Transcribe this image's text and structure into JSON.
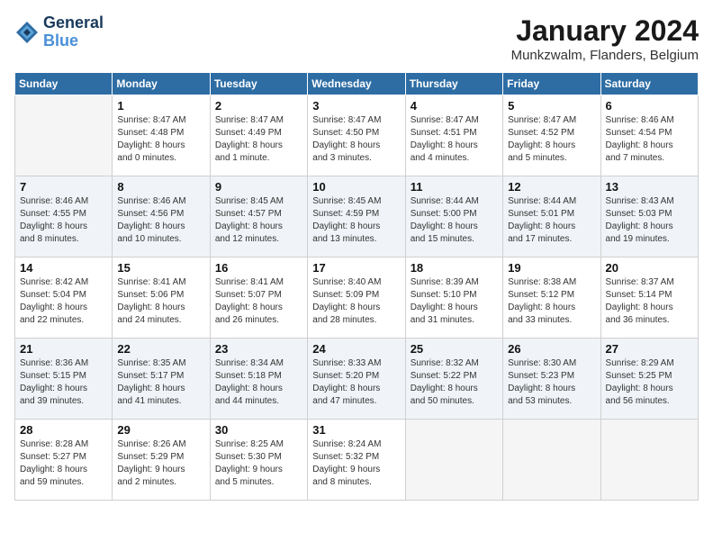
{
  "header": {
    "logo_line1": "General",
    "logo_line2": "Blue",
    "month": "January 2024",
    "location": "Munkzwalm, Flanders, Belgium"
  },
  "weekdays": [
    "Sunday",
    "Monday",
    "Tuesday",
    "Wednesday",
    "Thursday",
    "Friday",
    "Saturday"
  ],
  "weeks": [
    [
      {
        "day": "",
        "text": ""
      },
      {
        "day": "1",
        "text": "Sunrise: 8:47 AM\nSunset: 4:48 PM\nDaylight: 8 hours\nand 0 minutes."
      },
      {
        "day": "2",
        "text": "Sunrise: 8:47 AM\nSunset: 4:49 PM\nDaylight: 8 hours\nand 1 minute."
      },
      {
        "day": "3",
        "text": "Sunrise: 8:47 AM\nSunset: 4:50 PM\nDaylight: 8 hours\nand 3 minutes."
      },
      {
        "day": "4",
        "text": "Sunrise: 8:47 AM\nSunset: 4:51 PM\nDaylight: 8 hours\nand 4 minutes."
      },
      {
        "day": "5",
        "text": "Sunrise: 8:47 AM\nSunset: 4:52 PM\nDaylight: 8 hours\nand 5 minutes."
      },
      {
        "day": "6",
        "text": "Sunrise: 8:46 AM\nSunset: 4:54 PM\nDaylight: 8 hours\nand 7 minutes."
      }
    ],
    [
      {
        "day": "7",
        "text": "Sunrise: 8:46 AM\nSunset: 4:55 PM\nDaylight: 8 hours\nand 8 minutes."
      },
      {
        "day": "8",
        "text": "Sunrise: 8:46 AM\nSunset: 4:56 PM\nDaylight: 8 hours\nand 10 minutes."
      },
      {
        "day": "9",
        "text": "Sunrise: 8:45 AM\nSunset: 4:57 PM\nDaylight: 8 hours\nand 12 minutes."
      },
      {
        "day": "10",
        "text": "Sunrise: 8:45 AM\nSunset: 4:59 PM\nDaylight: 8 hours\nand 13 minutes."
      },
      {
        "day": "11",
        "text": "Sunrise: 8:44 AM\nSunset: 5:00 PM\nDaylight: 8 hours\nand 15 minutes."
      },
      {
        "day": "12",
        "text": "Sunrise: 8:44 AM\nSunset: 5:01 PM\nDaylight: 8 hours\nand 17 minutes."
      },
      {
        "day": "13",
        "text": "Sunrise: 8:43 AM\nSunset: 5:03 PM\nDaylight: 8 hours\nand 19 minutes."
      }
    ],
    [
      {
        "day": "14",
        "text": "Sunrise: 8:42 AM\nSunset: 5:04 PM\nDaylight: 8 hours\nand 22 minutes."
      },
      {
        "day": "15",
        "text": "Sunrise: 8:41 AM\nSunset: 5:06 PM\nDaylight: 8 hours\nand 24 minutes."
      },
      {
        "day": "16",
        "text": "Sunrise: 8:41 AM\nSunset: 5:07 PM\nDaylight: 8 hours\nand 26 minutes."
      },
      {
        "day": "17",
        "text": "Sunrise: 8:40 AM\nSunset: 5:09 PM\nDaylight: 8 hours\nand 28 minutes."
      },
      {
        "day": "18",
        "text": "Sunrise: 8:39 AM\nSunset: 5:10 PM\nDaylight: 8 hours\nand 31 minutes."
      },
      {
        "day": "19",
        "text": "Sunrise: 8:38 AM\nSunset: 5:12 PM\nDaylight: 8 hours\nand 33 minutes."
      },
      {
        "day": "20",
        "text": "Sunrise: 8:37 AM\nSunset: 5:14 PM\nDaylight: 8 hours\nand 36 minutes."
      }
    ],
    [
      {
        "day": "21",
        "text": "Sunrise: 8:36 AM\nSunset: 5:15 PM\nDaylight: 8 hours\nand 39 minutes."
      },
      {
        "day": "22",
        "text": "Sunrise: 8:35 AM\nSunset: 5:17 PM\nDaylight: 8 hours\nand 41 minutes."
      },
      {
        "day": "23",
        "text": "Sunrise: 8:34 AM\nSunset: 5:18 PM\nDaylight: 8 hours\nand 44 minutes."
      },
      {
        "day": "24",
        "text": "Sunrise: 8:33 AM\nSunset: 5:20 PM\nDaylight: 8 hours\nand 47 minutes."
      },
      {
        "day": "25",
        "text": "Sunrise: 8:32 AM\nSunset: 5:22 PM\nDaylight: 8 hours\nand 50 minutes."
      },
      {
        "day": "26",
        "text": "Sunrise: 8:30 AM\nSunset: 5:23 PM\nDaylight: 8 hours\nand 53 minutes."
      },
      {
        "day": "27",
        "text": "Sunrise: 8:29 AM\nSunset: 5:25 PM\nDaylight: 8 hours\nand 56 minutes."
      }
    ],
    [
      {
        "day": "28",
        "text": "Sunrise: 8:28 AM\nSunset: 5:27 PM\nDaylight: 8 hours\nand 59 minutes."
      },
      {
        "day": "29",
        "text": "Sunrise: 8:26 AM\nSunset: 5:29 PM\nDaylight: 9 hours\nand 2 minutes."
      },
      {
        "day": "30",
        "text": "Sunrise: 8:25 AM\nSunset: 5:30 PM\nDaylight: 9 hours\nand 5 minutes."
      },
      {
        "day": "31",
        "text": "Sunrise: 8:24 AM\nSunset: 5:32 PM\nDaylight: 9 hours\nand 8 minutes."
      },
      {
        "day": "",
        "text": ""
      },
      {
        "day": "",
        "text": ""
      },
      {
        "day": "",
        "text": ""
      }
    ]
  ]
}
